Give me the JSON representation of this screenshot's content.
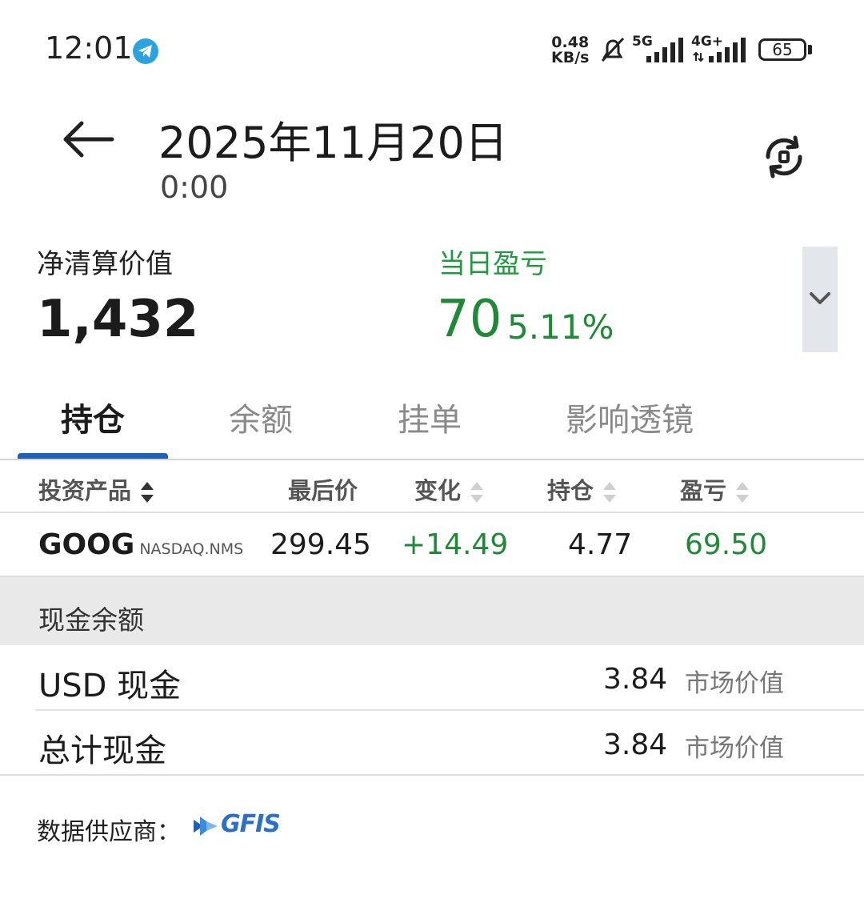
{
  "status_bar": {
    "time": "12:01",
    "net_speed_value": "0.48",
    "net_speed_unit": "KB/s",
    "network_primary": "5G",
    "network_secondary": "4G+",
    "battery": "65"
  },
  "header": {
    "date": "2025年11月20日",
    "time": "0:00"
  },
  "summary": {
    "net_liquidation_label": "净清算价值",
    "net_liquidation_value": "1,432",
    "daily_pnl_label": "当日盈亏",
    "daily_pnl_value": "70",
    "daily_pnl_percent": "5.11%"
  },
  "tabs": [
    {
      "label": "持仓",
      "active": true
    },
    {
      "label": "余额",
      "active": false
    },
    {
      "label": "挂单",
      "active": false
    },
    {
      "label": "影响透镜",
      "active": false
    }
  ],
  "table": {
    "columns": [
      "投资产品",
      "最后价",
      "变化",
      "持仓",
      "盈亏"
    ],
    "rows": [
      {
        "symbol": "GOOG",
        "exchange": "NASDAQ.NMS",
        "last": "299.45",
        "change": "+14.49",
        "position": "4.77",
        "pnl": "69.50"
      }
    ]
  },
  "cash": {
    "section_title": "现金余额",
    "rows": [
      {
        "label": "USD 现金",
        "value": "3.84",
        "suffix": "市场价值"
      },
      {
        "label": "总计现金",
        "value": "3.84",
        "suffix": "市场价值"
      }
    ]
  },
  "footer": {
    "provider_label": "数据供应商：",
    "provider_logo": "GFIS"
  },
  "colors": {
    "accent_blue": "#1e62b8",
    "positive_green": "#1f8a36"
  }
}
